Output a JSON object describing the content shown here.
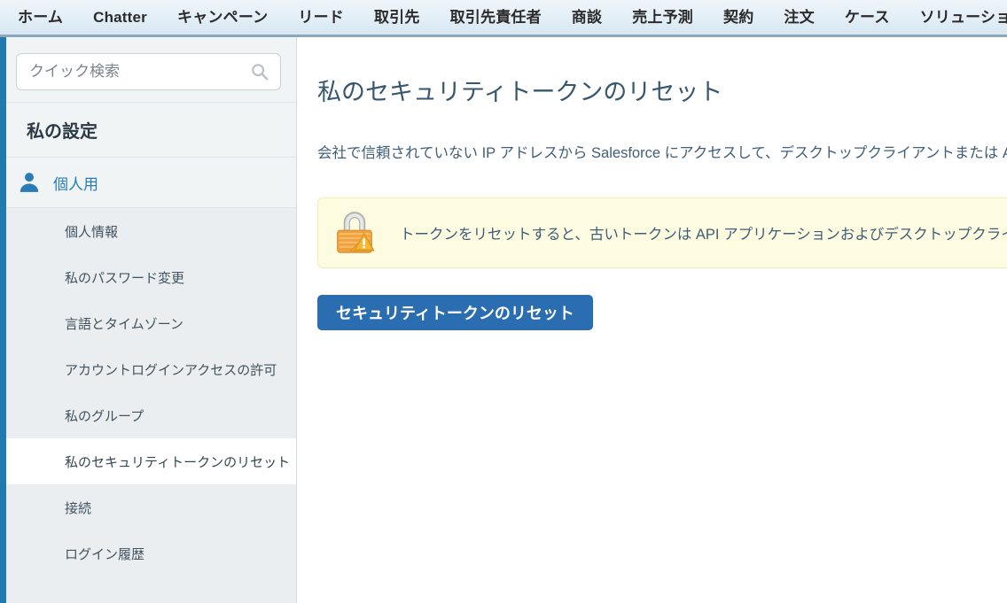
{
  "top_nav": {
    "tabs": [
      {
        "label": "ホーム",
        "name": "nav-tab-home"
      },
      {
        "label": "Chatter",
        "name": "nav-tab-chatter"
      },
      {
        "label": "キャンペーン",
        "name": "nav-tab-campaigns"
      },
      {
        "label": "リード",
        "name": "nav-tab-leads"
      },
      {
        "label": "取引先",
        "name": "nav-tab-accounts"
      },
      {
        "label": "取引先責任者",
        "name": "nav-tab-contacts"
      },
      {
        "label": "商談",
        "name": "nav-tab-opportunities"
      },
      {
        "label": "売上予測",
        "name": "nav-tab-forecasts"
      },
      {
        "label": "契約",
        "name": "nav-tab-contracts"
      },
      {
        "label": "注文",
        "name": "nav-tab-orders"
      },
      {
        "label": "ケース",
        "name": "nav-tab-cases"
      },
      {
        "label": "ソリューション",
        "name": "nav-tab-solutions"
      }
    ]
  },
  "sidebar": {
    "search": {
      "placeholder": "クイック検索",
      "value": "",
      "icon": "search-icon"
    },
    "heading": "私の設定",
    "section": {
      "label": "個人用",
      "icon": "person-icon"
    },
    "items": [
      {
        "label": "個人情報",
        "name": "sidebar-item-personal-information",
        "active": false
      },
      {
        "label": "私のパスワード変更",
        "name": "sidebar-item-change-my-password",
        "active": false
      },
      {
        "label": "言語とタイムゾーン",
        "name": "sidebar-item-language-and-time-zone",
        "active": false
      },
      {
        "label": "アカウントログインアクセスの許可",
        "name": "sidebar-item-grant-account-login-access",
        "active": false
      },
      {
        "label": "私のグループ",
        "name": "sidebar-item-my-groups",
        "active": false
      },
      {
        "label": "私のセキュリティトークンのリセット",
        "name": "sidebar-item-reset-my-security-token",
        "active": true
      },
      {
        "label": "接続",
        "name": "sidebar-item-connections",
        "active": false
      },
      {
        "label": "ログイン履歴",
        "name": "sidebar-item-login-history",
        "active": false
      }
    ]
  },
  "main": {
    "title": "私のセキュリティトークンのリセット",
    "description": "会社で信頼されていない IP アドレスから Salesforce にアクセスして、デスクトップクライアントまたは API",
    "warning": {
      "icon": "lock-warning-icon",
      "text": "トークンをリセットすると、古いトークンは API アプリケーションおよびデスクトップクライアントで"
    },
    "reset_button_label": "セキュリティトークンのリセット"
  },
  "colors": {
    "accent_blue": "#2a6db0",
    "sidebar_stripe": "#1e7ab0",
    "link_blue": "#2a7cb5",
    "title_blue": "#37576e",
    "warning_bg": "#fdfbe0",
    "warning_border": "#f4ecb0",
    "sidebar_bg": "#eaeef0"
  }
}
